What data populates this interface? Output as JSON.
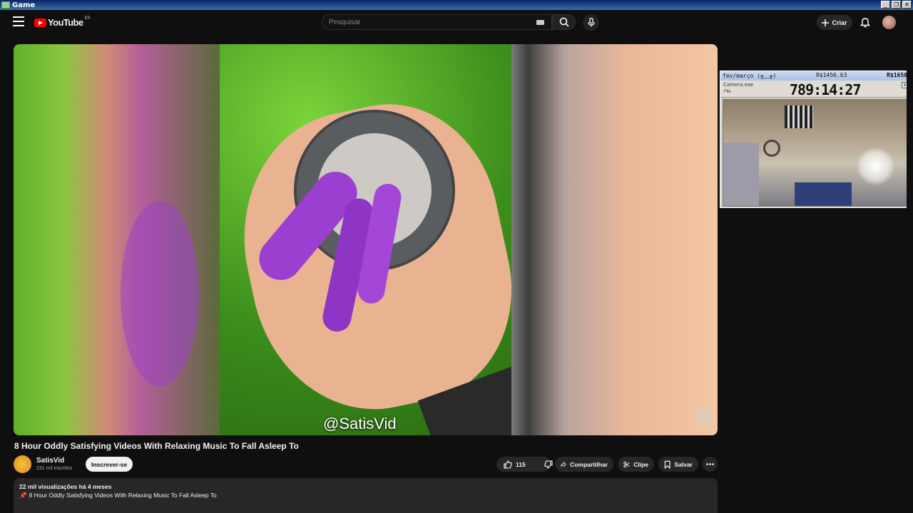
{
  "window": {
    "title": "Game",
    "buttons": [
      "_",
      "❐",
      "✕"
    ]
  },
  "header": {
    "logo_text": "YouTube",
    "country_code": "BR",
    "search_placeholder": "Pesquisar",
    "create_label": "Criar"
  },
  "video": {
    "watermark": "@SatisVid",
    "title": "8 Hour Oddly Satisfying Videos With Relaxing Music To Fall Asleep To"
  },
  "widget": {
    "period": "fev/março (╥﹏╥)",
    "amount": "R$1456.63",
    "goal": "R$1650",
    "subtitle": "Camera.exe",
    "file_menu": "File",
    "timer": "789:14:27",
    "close": "x"
  },
  "channel": {
    "name": "SatisVid",
    "subscribers": "231 mil inscritos",
    "subscribe_label": "Inscrever-se"
  },
  "actions": {
    "likes": "115",
    "share_label": "Compartilhar",
    "clip_label": "Clipe",
    "save_label": "Salvar"
  },
  "description": {
    "meta": "22 mil visualizações  há 4 meses",
    "first_line": "8 Hour Oddly Satisfying Videos With Relaxing Music To Fall Asleep To"
  },
  "colors": {
    "accent": "#ff0000",
    "background": "#0f0f0f",
    "pill": "#272727"
  }
}
